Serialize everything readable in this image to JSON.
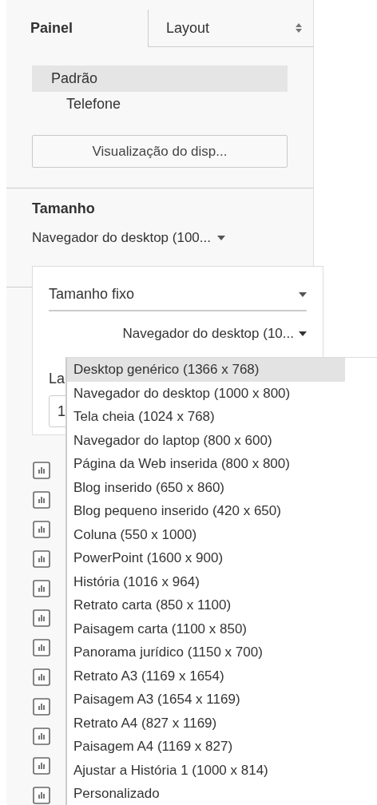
{
  "tabs": [
    {
      "label": "Painel",
      "selected": true
    },
    {
      "label": "Layout",
      "selected": false
    }
  ],
  "devices": [
    {
      "label": "Padrão",
      "selected": true,
      "children": [
        {
          "label": "Telefone",
          "selected": false
        }
      ]
    }
  ],
  "preview_button": "Visualização do disp...",
  "size_section": {
    "title": "Tamanho",
    "dropdown": "Navegador do desktop (100..."
  },
  "size_popover": {
    "mode": "Tamanho fixo",
    "preset": "Navegador do desktop (10...",
    "width_label": "La",
    "width_value": "1"
  },
  "preset_menu": [
    {
      "label": "Desktop genérico (1366 x 768)",
      "selected": true
    },
    {
      "label": "Navegador do desktop (1000 x 800)",
      "selected": false
    },
    {
      "label": "Tela cheia (1024 x 768)",
      "selected": false
    },
    {
      "label": "Navegador do laptop (800 x 600)",
      "selected": false
    },
    {
      "label": "Página da Web inserida (800 x 800)",
      "selected": false
    },
    {
      "label": "Blog inserido (650 x 860)",
      "selected": false
    },
    {
      "label": "Blog pequeno inserido (420 x 650)",
      "selected": false
    },
    {
      "label": "Coluna (550 x 1000)",
      "selected": false
    },
    {
      "label": "PowerPoint (1600 x 900)",
      "selected": false
    },
    {
      "label": "História (1016 x 964)",
      "selected": false
    },
    {
      "label": "Retrato carta (850 x 1100)",
      "selected": false
    },
    {
      "label": "Paisagem carta (1100 x 850)",
      "selected": false
    },
    {
      "label": "Panorama jurídico (1150 x 700)",
      "selected": false
    },
    {
      "label": "Retrato A3 (1169 x 1654)",
      "selected": false
    },
    {
      "label": "Paisagem A3 (1654 x 1169)",
      "selected": false
    },
    {
      "label": "Retrato A4 (827 x 1169)",
      "selected": false
    },
    {
      "label": "Paisagem A4 (1169 x 827)",
      "selected": false
    },
    {
      "label": "Ajustar a História 1 (1000 x 814)",
      "selected": false
    },
    {
      "label": "Personalizado",
      "selected": false
    }
  ]
}
